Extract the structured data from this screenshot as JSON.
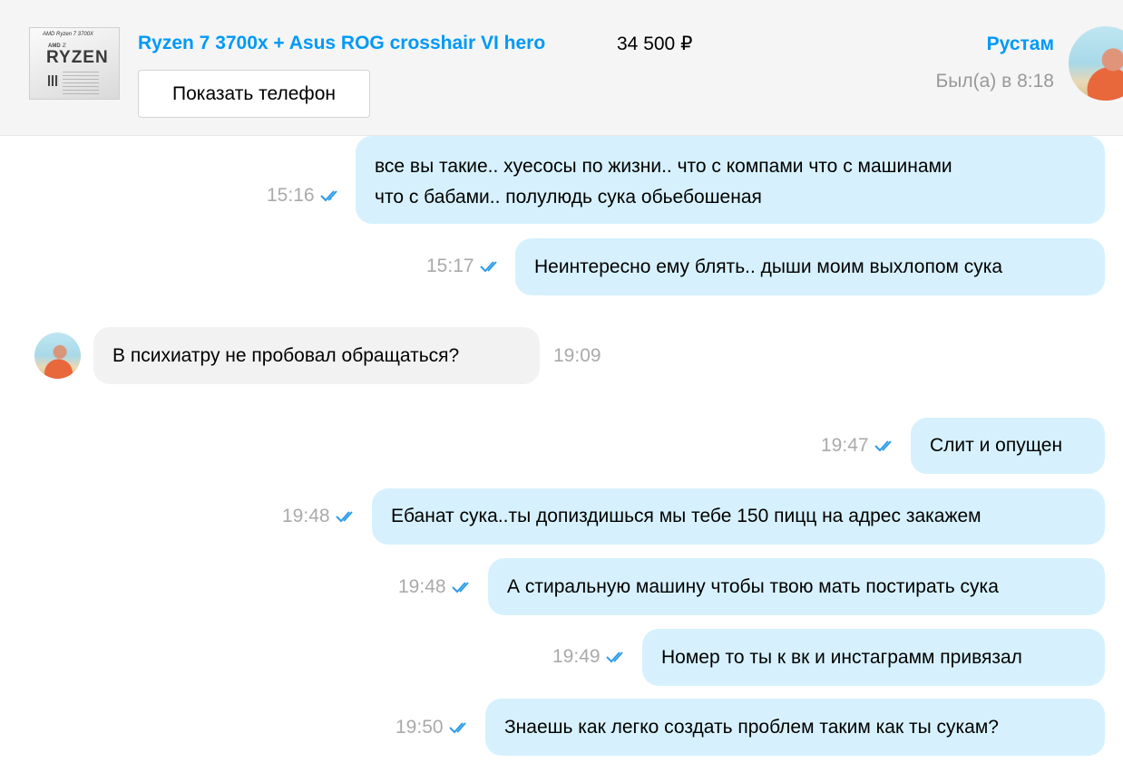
{
  "listing": {
    "thumbnail_icon": "ryzen-cpu-photo",
    "thumbnail_text_top": "AMD Ryzen 7 3700X",
    "thumbnail_text_brand": "AMD ℤ",
    "thumbnail_text_ryzen": "RYZEN",
    "title": "Ryzen 7 3700x + Asus ROG crosshair VI hero",
    "price": "34 500 ₽",
    "show_phone_label": "Показать телефон"
  },
  "contact": {
    "name": "Рустам",
    "status": "Был(а) в 8:18"
  },
  "colors": {
    "accent": "#0099f7",
    "outgoing_bubble": "#d6f1fd",
    "incoming_bubble": "#f2f2f2",
    "read_check": "#2e9ce8"
  },
  "messages": [
    {
      "direction": "out",
      "lines": [
        "все вы такие.. хуесосы по жизни.. что с компами что с машинами",
        "что с бабами.. полулюдь сука обьебошеная"
      ],
      "time": "15:16",
      "read": true
    },
    {
      "direction": "out",
      "text": "Неинтересно ему блять.. дыши моим выхлопом сука",
      "time": "15:17",
      "read": true
    },
    {
      "direction": "in",
      "text": "В психиатру не пробовал обращаться?",
      "time": "19:09"
    },
    {
      "direction": "out",
      "text": "Слит и опущен",
      "time": "19:47",
      "read": true
    },
    {
      "direction": "out",
      "text": "Ебанат сука..ты допиздишься мы тебе 150 пицц на адрес закажем",
      "time": "19:48",
      "read": true
    },
    {
      "direction": "out",
      "text": "А стиральную машину чтобы твою мать постирать сука",
      "time": "19:48",
      "read": true
    },
    {
      "direction": "out",
      "text": "Номер то ты к вк и инстаграмм привязал",
      "time": "19:49",
      "read": true
    },
    {
      "direction": "out",
      "text": "Знаешь как легко создать проблем таким как ты сукам?",
      "time": "19:50",
      "read": true
    }
  ]
}
